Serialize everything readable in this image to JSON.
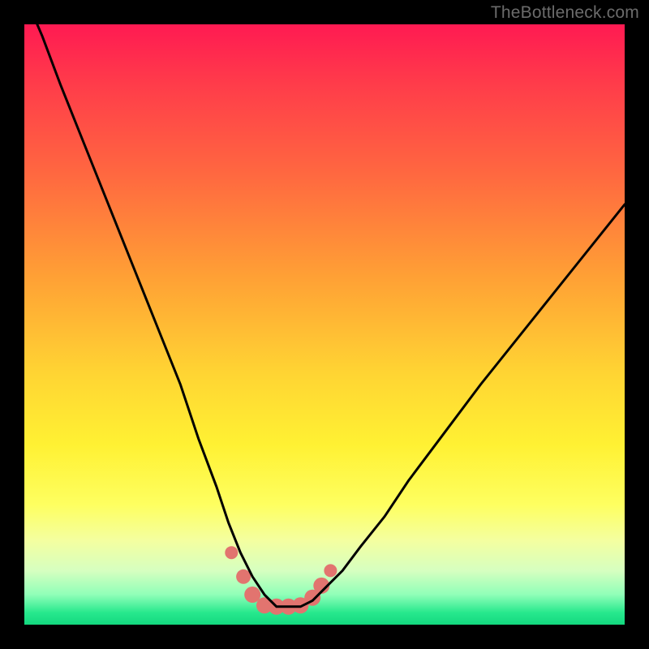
{
  "watermark": "TheBottleneck.com",
  "colors": {
    "frame": "#000000",
    "curve_stroke": "#000000",
    "marker_fill": "#e2746f",
    "gradient_top": "#ff1a52",
    "gradient_bottom": "#13d97f"
  },
  "chart_data": {
    "type": "line",
    "title": "",
    "xlabel": "",
    "ylabel": "",
    "xlim": [
      0,
      100
    ],
    "ylim": [
      0,
      100
    ],
    "note": "Axes are unlabeled; values are estimated from pixel positions on a 0–100 normalized scale where y=0 is the bottom edge and y=100 is the top edge of the gradient plot area.",
    "series": [
      {
        "name": "bottleneck-curve",
        "x": [
          0,
          3,
          6,
          10,
          14,
          18,
          22,
          26,
          29,
          32,
          34,
          36,
          38,
          40,
          42,
          44,
          46,
          48,
          50,
          53,
          56,
          60,
          64,
          70,
          76,
          84,
          92,
          100
        ],
        "y": [
          105,
          98,
          90,
          80,
          70,
          60,
          50,
          40,
          31,
          23,
          17,
          12,
          8,
          5,
          3,
          3,
          3,
          4,
          6,
          9,
          13,
          18,
          24,
          32,
          40,
          50,
          60,
          70
        ]
      }
    ],
    "markers": {
      "name": "valley-markers",
      "x": [
        34.5,
        36.5,
        38.0,
        40.0,
        42.0,
        44.0,
        46.0,
        48.0,
        49.5,
        51.0
      ],
      "y": [
        12.0,
        8.0,
        5.0,
        3.2,
        3.0,
        3.0,
        3.2,
        4.5,
        6.5,
        9.0
      ],
      "r": [
        8,
        9,
        10,
        10,
        10,
        10,
        10,
        10,
        10,
        8
      ]
    }
  }
}
